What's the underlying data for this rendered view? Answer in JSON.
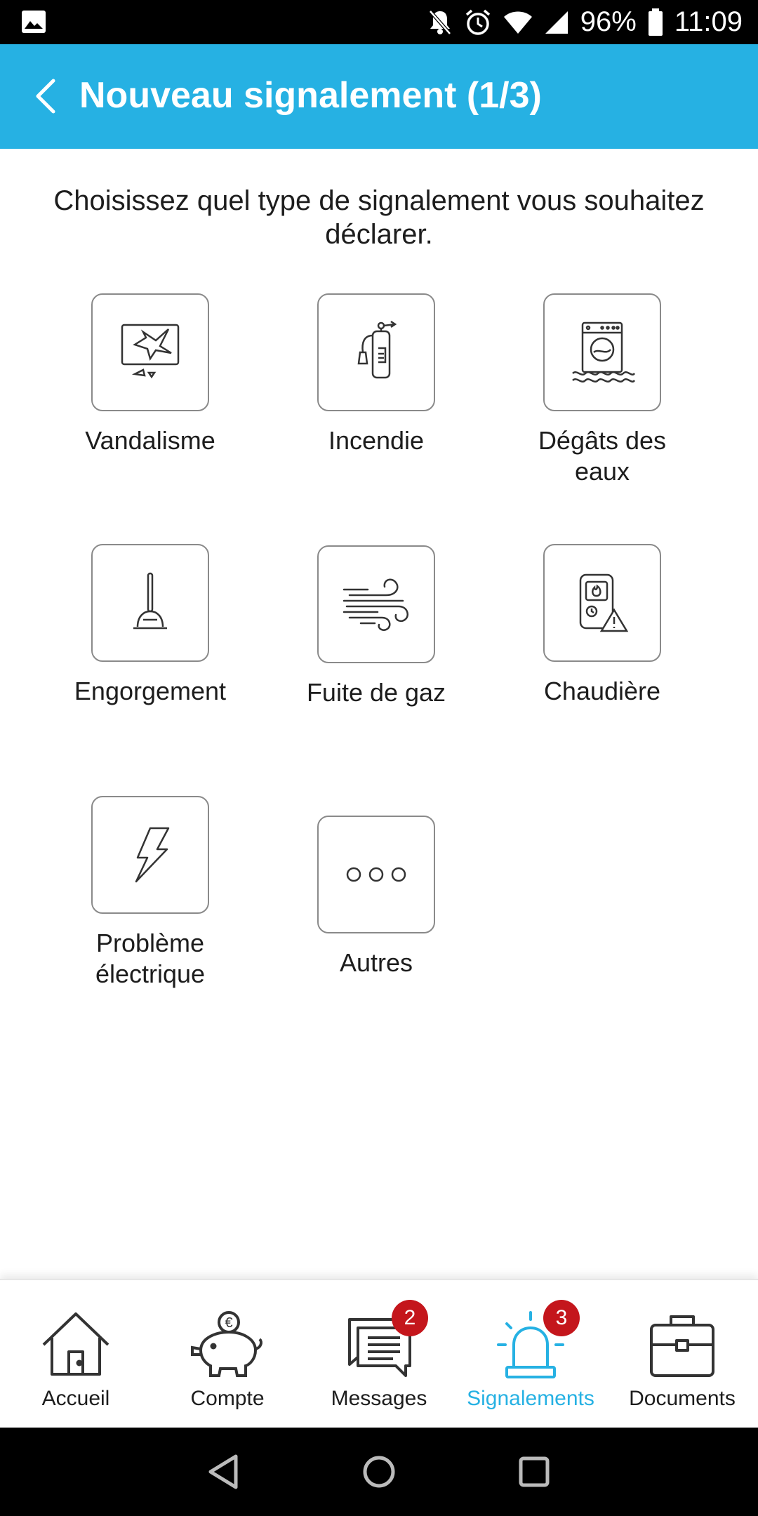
{
  "status_bar": {
    "battery": "96%",
    "time": "11:09"
  },
  "header": {
    "title": "Nouveau signalement (1/3)"
  },
  "intro": "Choisissez quel type de signalement vous souhaitez déclarer.",
  "tiles": [
    {
      "label": "Vandalisme",
      "icon": "broken-screen-icon"
    },
    {
      "label": "Incendie",
      "icon": "fire-extinguisher-icon"
    },
    {
      "label": "Dégâts des eaux",
      "icon": "flooded-washing-machine-icon"
    },
    {
      "label": "Engorgement",
      "icon": "plunger-icon"
    },
    {
      "label": "Fuite de gaz",
      "icon": "wind-icon"
    },
    {
      "label": "Chaudière",
      "icon": "boiler-warning-icon"
    },
    {
      "label": "Problème électrique",
      "icon": "lightning-icon"
    },
    {
      "label": "Autres",
      "icon": "more-dots-icon"
    }
  ],
  "bottom_nav": {
    "items": [
      {
        "label": "Accueil",
        "icon": "home-icon"
      },
      {
        "label": "Compte",
        "icon": "piggy-bank-icon"
      },
      {
        "label": "Messages",
        "icon": "messages-icon",
        "badge": "2"
      },
      {
        "label": "Signalements",
        "icon": "alarm-light-icon",
        "badge": "3",
        "active": true
      },
      {
        "label": "Documents",
        "icon": "briefcase-icon"
      }
    ]
  },
  "colors": {
    "accent": "#26b1e3",
    "badge": "#c4161c"
  }
}
